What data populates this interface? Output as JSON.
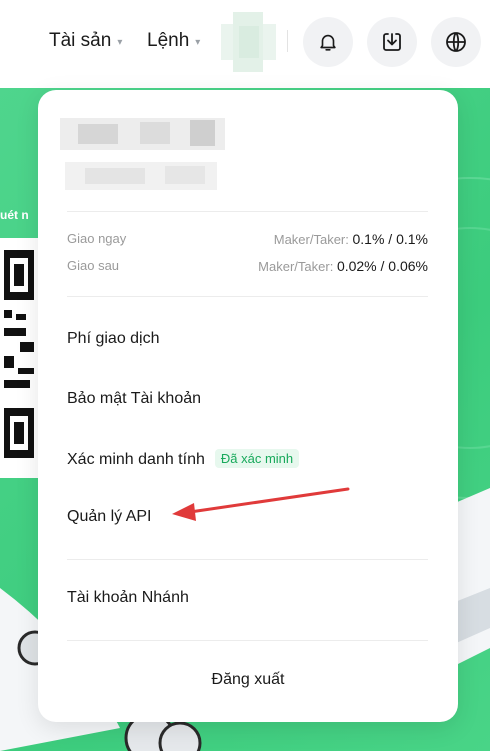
{
  "nav": {
    "assets_label": "Tài sản",
    "orders_label": "Lệnh",
    "caret": "▾"
  },
  "panel": {
    "fees": [
      {
        "label": "Giao ngay",
        "prefix": "Maker/Taker:",
        "value": "0.1% / 0.1%"
      },
      {
        "label": "Giao sau",
        "prefix": "Maker/Taker:",
        "value": "0.02% / 0.06%"
      }
    ],
    "menu": {
      "fees_label": "Phí giao dịch",
      "security_label": "Bảo mật Tài khoản",
      "kyc_label": "Xác minh danh tính",
      "kyc_badge": "Đã xác minh",
      "api_label": "Quản lý API",
      "subaccount_label": "Tài khoản Nhánh",
      "logout_label": "Đăng xuất"
    }
  },
  "background": {
    "scan_text": "uét n"
  },
  "colors": {
    "accent_green": "#3ccc7d",
    "badge_text": "#18a95b",
    "badge_bg": "#e7f8ee",
    "annotation_arrow": "#e03a3a"
  }
}
